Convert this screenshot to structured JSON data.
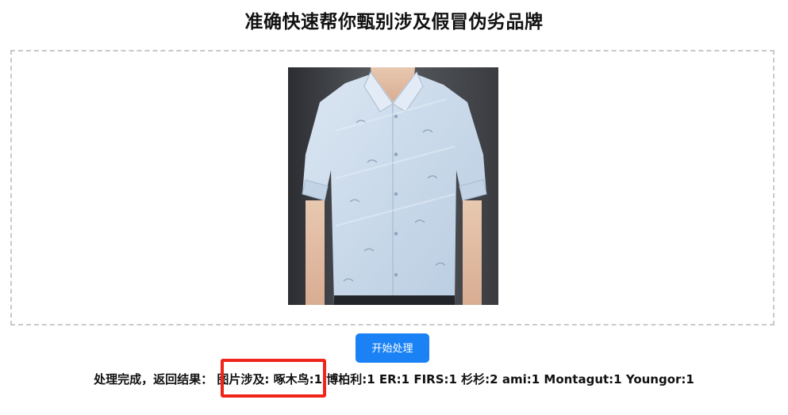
{
  "page": {
    "title": "准确快速帮你甄别涉及假冒伪劣品牌"
  },
  "upload": {
    "preview_alt": "shirt-photo"
  },
  "actions": {
    "start_label": "开始处理"
  },
  "result": {
    "text": "处理完成，返回结果： 图片涉及: 啄木鸟:1 博柏利:1 ER:1 FIRS:1 杉杉:2 ami:1 Montagut:1 Youngor:1"
  },
  "colors": {
    "accent": "#1a82f5",
    "highlight": "#f02418",
    "border": "#c9c9c9"
  }
}
